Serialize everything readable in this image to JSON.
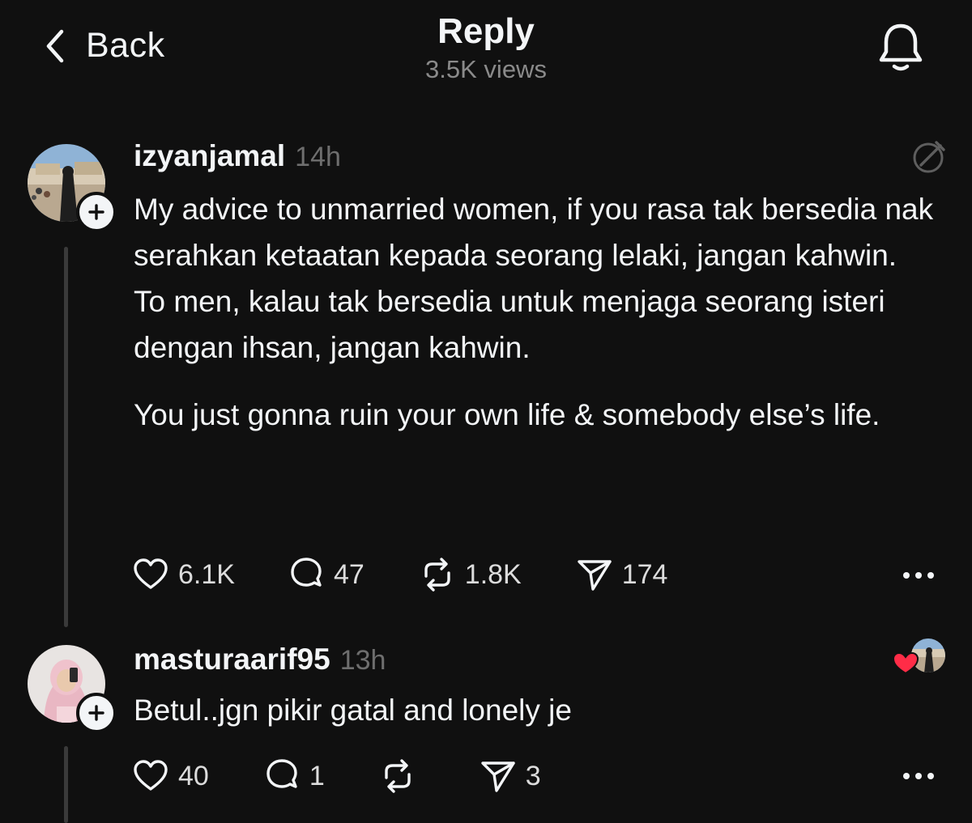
{
  "header": {
    "back_label": "Back",
    "title": "Reply",
    "views": "3.5K views"
  },
  "posts": [
    {
      "username": "izyanjamal",
      "time": "14h",
      "paragraphs": [
        "My advice to unmarried women, if you rasa tak bersedia nak serahkan ketaatan kepada seorang lelaki, jangan kahwin. To men, kalau tak bersedia untuk menjaga seorang isteri dengan ihsan, jangan kahwin.",
        "You just gonna ruin your own life & somebody else’s life."
      ],
      "likes": "6.1K",
      "replies": "47",
      "reposts": "1.8K",
      "shares": "174"
    },
    {
      "username": "masturaarif95",
      "time": "13h",
      "paragraphs": [
        "Betul..jgn pikir gatal and lonely je"
      ],
      "likes": "40",
      "replies": "1",
      "reposts": "",
      "shares": "3",
      "liked_by_author": true
    }
  ],
  "icons": {
    "back": "chevron-left-icon",
    "notifications": "bell-icon",
    "like": "heart-icon",
    "reply": "comment-icon",
    "repost": "repost-icon",
    "share": "send-icon",
    "more": "more-icon",
    "follow": "plus-icon"
  },
  "colors": {
    "background": "#101010",
    "text": "#f3f5f7",
    "muted": "#8a8a8a",
    "heart": "#ff2c47"
  }
}
